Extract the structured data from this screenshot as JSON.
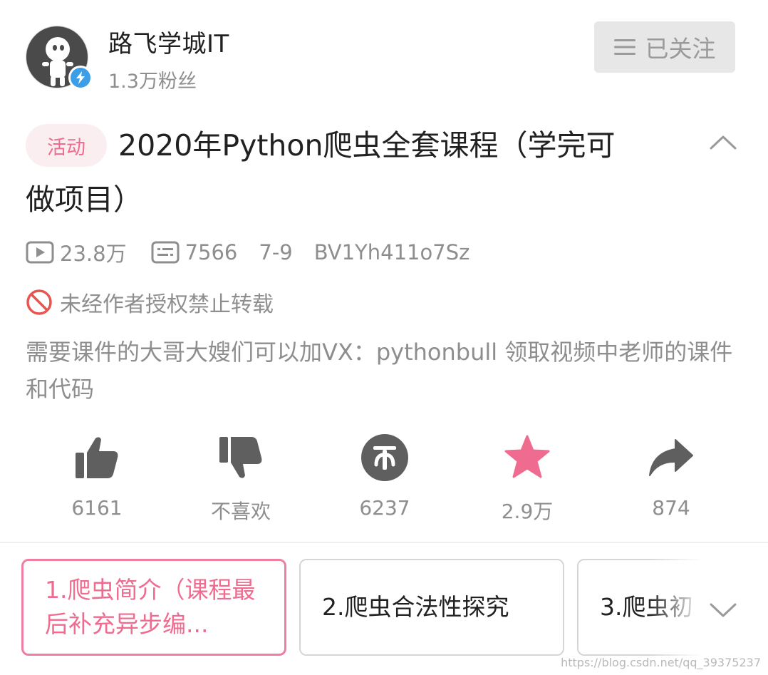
{
  "uploader": {
    "name": "路飞学城IT",
    "fans": "1.3万粉丝",
    "follow_label": "已关注"
  },
  "video": {
    "tag": "活动",
    "title_line1": "2020年Python爬虫全套课程（学完可",
    "title_line2": "做项目）",
    "stats": {
      "views": "23.8万",
      "danmaku": "7566",
      "date": "7-9",
      "bvid": "BV1Yh411o7Sz"
    },
    "no_reprint": "未经作者授权禁止转载",
    "description": "需要课件的大哥大嫂们可以加VX：pythonbull 领取视频中老师的课件和代码"
  },
  "actions": {
    "like": "6161",
    "dislike": "不喜欢",
    "coin": "6237",
    "favorite": "2.9万",
    "share": "874"
  },
  "episodes": [
    {
      "label": "1.爬虫简介（课程最后补充异步编..."
    },
    {
      "label": "2.爬虫合法性探究"
    },
    {
      "label": "3.爬虫初"
    }
  ],
  "watermark": "https://blog.csdn.net/qq_39375237",
  "colors": {
    "accent_pink": "#f06b90",
    "tag_bg": "#fbeef1",
    "verify_blue": "#3d9ee8",
    "icon_gray": "#5f5f5f",
    "text_gray": "#8e8e8e"
  }
}
